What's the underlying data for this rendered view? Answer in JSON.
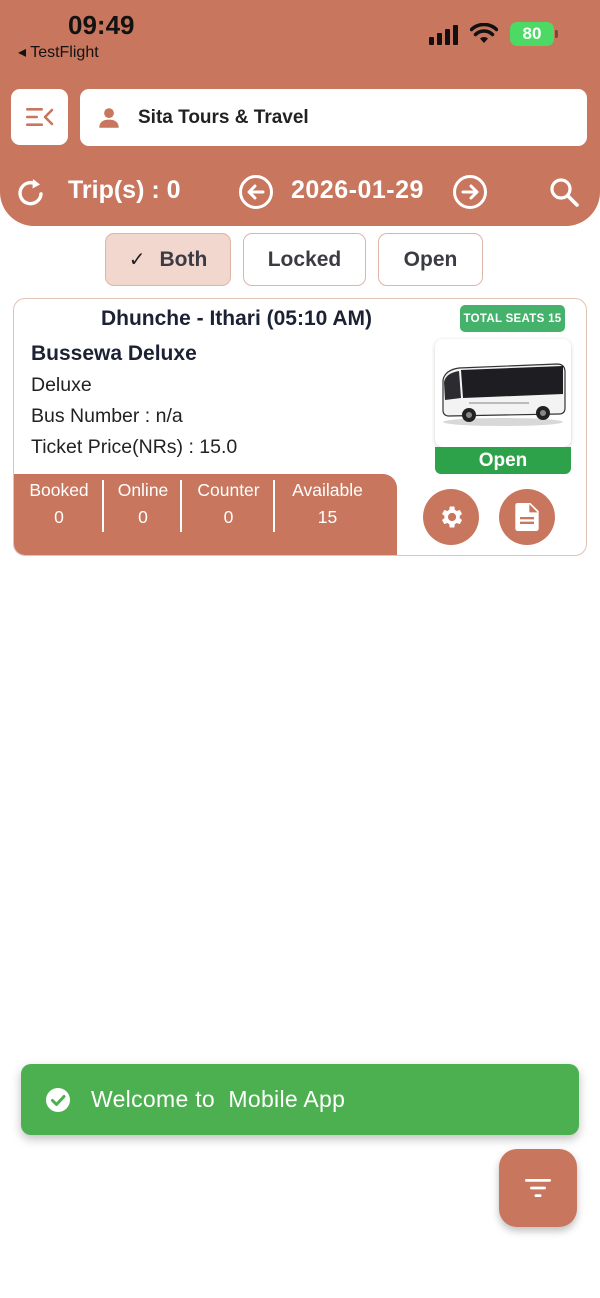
{
  "status_bar": {
    "time": "09:49",
    "back_app": "◂ TestFlight",
    "battery": "80"
  },
  "header": {
    "company_name": "Sita Tours & Travel",
    "trip_count": "Trip(s) : 0",
    "date": "2026-01-29"
  },
  "filters": [
    {
      "label": "Both",
      "selected": true
    },
    {
      "label": "Locked",
      "selected": false
    },
    {
      "label": "Open",
      "selected": false
    }
  ],
  "trip_card": {
    "route": "Dhunche - Ithari (05:10 AM)",
    "total_seats": "TOTAL SEATS 15",
    "bus_name": "Bussewa Deluxe",
    "bus_type": "Deluxe",
    "bus_number": "Bus Number : n/a",
    "ticket_price": "Ticket Price(NRs) : 15.0",
    "status": "Open",
    "stats": [
      {
        "label": "Booked",
        "value": "0"
      },
      {
        "label": "Online",
        "value": "0"
      },
      {
        "label": "Counter",
        "value": "0"
      },
      {
        "label": "Available",
        "value": "15"
      }
    ]
  },
  "toast": {
    "message": "Welcome to  Mobile App"
  },
  "colors": {
    "primary": "#c8765d",
    "success": "#4caf50",
    "open_status": "#2ea24b"
  },
  "icons": [
    "menu-collapse-icon",
    "person-icon",
    "refresh-icon",
    "arrow-left-circle-icon",
    "arrow-right-circle-icon",
    "search-icon",
    "check-icon",
    "bus-image",
    "gear-icon",
    "document-icon",
    "check-circle-icon",
    "filter-icon"
  ]
}
